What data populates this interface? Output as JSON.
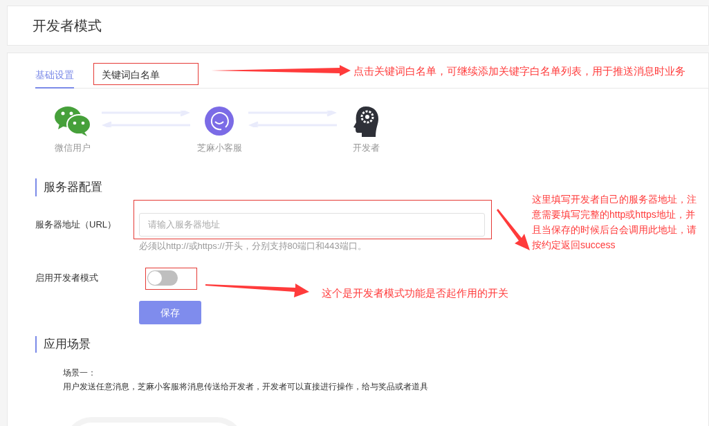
{
  "header": {
    "title": "开发者模式"
  },
  "tabs": [
    {
      "label": "基础设置",
      "selected": true
    },
    {
      "label": "关键词白名单",
      "selected": false
    }
  ],
  "flow": [
    {
      "kind": "wechat",
      "label": "微信用户"
    },
    {
      "kind": "bot",
      "label": "芝麻小客服"
    },
    {
      "kind": "developer",
      "label": "开发者"
    }
  ],
  "server_config": {
    "heading": "服务器配置",
    "url_label": "服务器地址（URL）",
    "placeholder": "请输入服务器地址",
    "hint": "必须以http://或https://开头，分别支持80端口和443端口。",
    "toggle_label": "启用开发者模式",
    "toggle_on": false,
    "save_button": "保存"
  },
  "scenarios": {
    "heading": "应用场景",
    "items": [
      {
        "title": "场景一：",
        "text": "用户发送任意消息，芝麻小客服将消息传送给开发者，开发者可以直接进行操作，给与奖品或者道具"
      }
    ]
  },
  "annotations": [
    {
      "kind": "tab",
      "text": "点击关键词白名单，可继续添加关键字白名单列表，用于推送消息时业务"
    },
    {
      "kind": "url",
      "text": "这里填写开发者自己的服务器地址，注意需要填写完整的http或https地址，并且当保存的时候后台会调用此地址，请按约定返回success"
    },
    {
      "kind": "toggle",
      "text": "这个是开发者模式功能是否起作用的开关"
    }
  ]
}
